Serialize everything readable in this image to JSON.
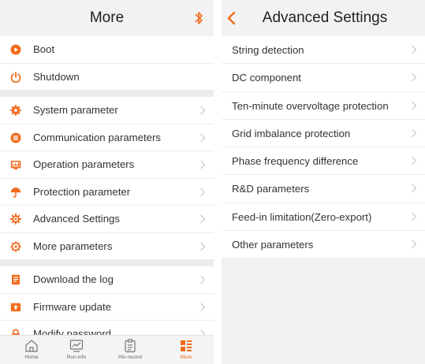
{
  "left": {
    "title": "More",
    "header_icon": "bluetooth-icon",
    "groups": [
      [
        {
          "label": "Boot",
          "icon": "power-on-icon",
          "chevron": false
        },
        {
          "label": "Shutdown",
          "icon": "power-off-icon",
          "chevron": false
        }
      ],
      [
        {
          "label": "System parameter",
          "icon": "gear-icon",
          "chevron": true
        },
        {
          "label": "Communication parameters",
          "icon": "communication-icon",
          "chevron": true
        },
        {
          "label": "Operation parameters",
          "icon": "operation-icon",
          "chevron": true
        },
        {
          "label": "Protection parameter",
          "icon": "umbrella-icon",
          "chevron": true
        },
        {
          "label": "Advanced Settings",
          "icon": "advanced-gear-icon",
          "chevron": true
        },
        {
          "label": "More parameters",
          "icon": "gear-outline-icon",
          "chevron": true
        }
      ],
      [
        {
          "label": "Download the log",
          "icon": "log-icon",
          "chevron": true
        },
        {
          "label": "Firmware update",
          "icon": "firmware-icon",
          "chevron": true
        },
        {
          "label": "Modify password",
          "icon": "lock-icon",
          "chevron": true
        }
      ]
    ],
    "tabs": [
      {
        "label": "Home",
        "icon": "home-icon",
        "active": false
      },
      {
        "label": "Run-info",
        "icon": "monitor-icon",
        "active": false
      },
      {
        "label": "His-record",
        "icon": "clipboard-icon",
        "active": false
      },
      {
        "label": "More",
        "icon": "more-grid-icon",
        "active": true
      }
    ]
  },
  "right": {
    "title": "Advanced Settings",
    "items": [
      {
        "label": "String detection"
      },
      {
        "label": "DC component"
      },
      {
        "label": "Ten-minute overvoltage protection"
      },
      {
        "label": "Grid imbalance protection"
      },
      {
        "label": "Phase frequency difference"
      },
      {
        "label": "R&D parameters"
      },
      {
        "label": "Feed-in limitation(Zero-export)"
      },
      {
        "label": "Other parameters"
      }
    ]
  },
  "colors": {
    "accent": "#f26b1d",
    "chevron": "#c8c8c8",
    "text": "#333333"
  }
}
